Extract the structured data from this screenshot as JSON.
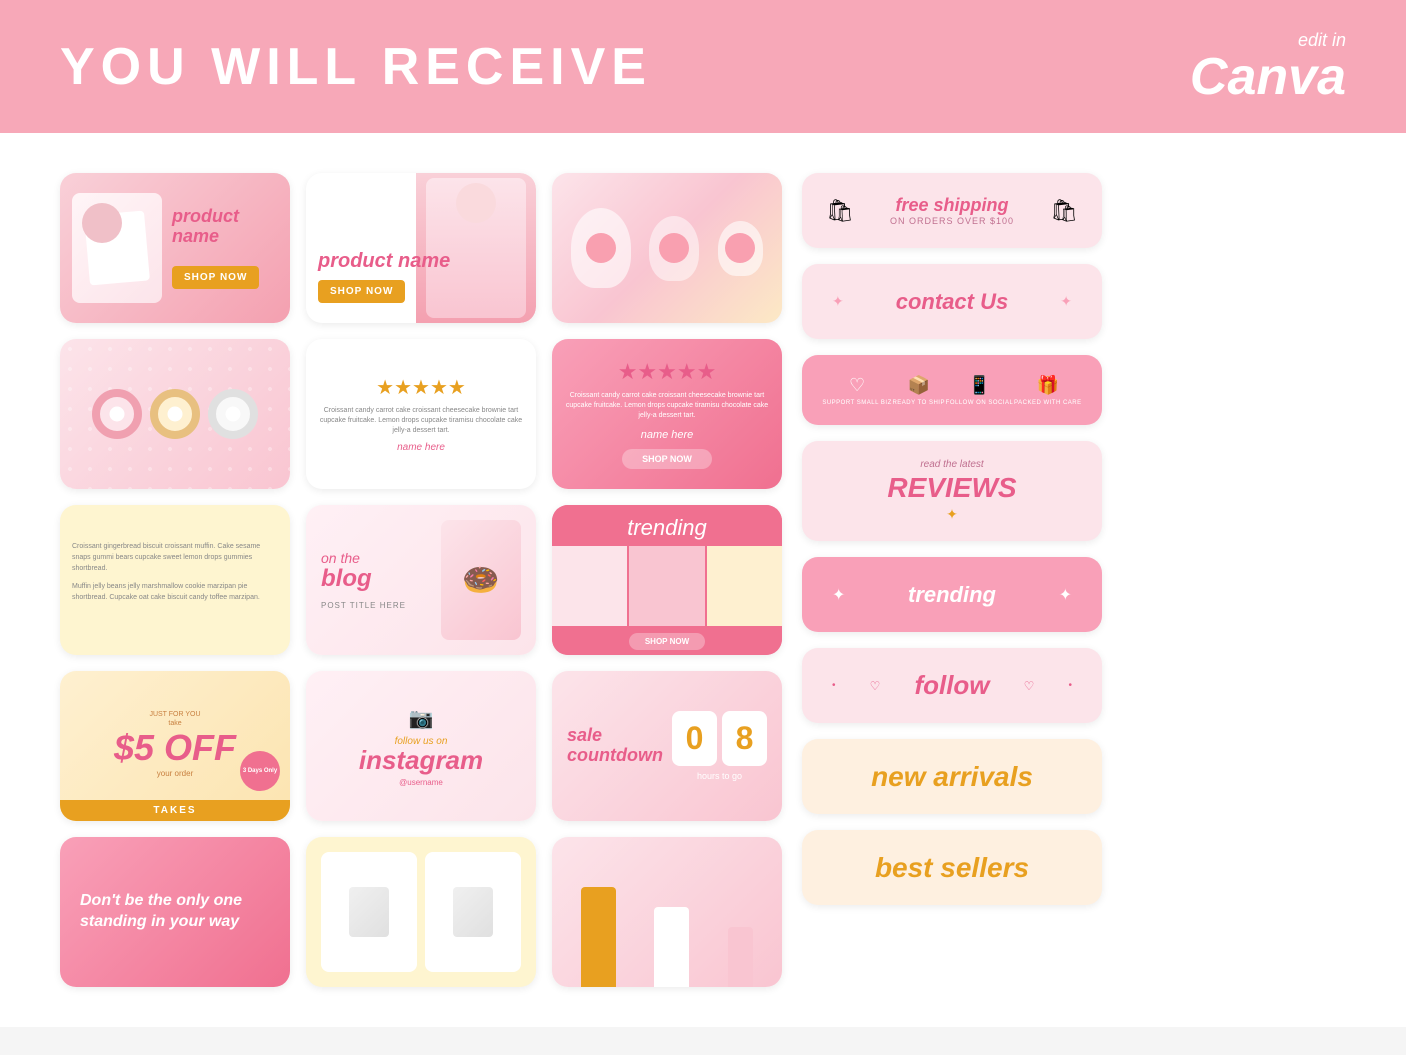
{
  "header": {
    "title": "YOU WILL RECEIVE",
    "canva_edit": "edit in",
    "canva_name": "Canva"
  },
  "cards": {
    "product1": {
      "name": "product name",
      "btn": "SHOP NOW"
    },
    "product2": {
      "name": "product name",
      "btn": "SHOP NOW"
    },
    "review1": {
      "stars": "★★★★★",
      "text": "Croissant candy carrot cake croissant cheesecake brownie tart cupcake fruitcake. Lemon drops cupcake tiramisu chocolate cake jelly-a dessert tart.",
      "name": "name here"
    },
    "review2": {
      "stars": "★★★★★",
      "text": "Croissant candy carrot cake croissant cheesecake brownie tart cupcake fruitcake. Lemon drops cupcake tiramisu chocolate cake jelly-a dessert tart.",
      "name": "name here",
      "btn": "SHOP NOW"
    },
    "blogText": {
      "para1": "Croissant gingerbread biscuit croissant muffin. Cake sesame snaps gummi bears cupcake sweet lemon drops gummies shortbread.",
      "para2": "Muffin jelly beans jelly marshmallow cookie marzipan pie shortbread. Cupcake oat cake biscuit candy toffee marzipan."
    },
    "blog": {
      "prefix": "on the",
      "title": "blog",
      "post": "POST TITLE HERE"
    },
    "trending": {
      "title": "trending",
      "btn": "SHOP NOW"
    },
    "discount": {
      "just": "JUST FOR YOU",
      "take": "take",
      "amount": "$5 OFF",
      "sub": "your order",
      "badge": "3 Days Only",
      "footer": "TAKES"
    },
    "instagram": {
      "follow_prefix": "follow us on",
      "platform": "instagram",
      "username": "@username"
    },
    "countdown": {
      "label": "sale countdown",
      "num1": "0",
      "num2": "8",
      "sub": "hours to go"
    },
    "motivational": {
      "text": "Don't be the only one standing in your way"
    },
    "candle": {
      "alt": "candle product"
    }
  },
  "sidebar": {
    "shipping": {
      "main": "free shipping",
      "sub": "ON ORDERS OVER $100",
      "icon_left": "🛍",
      "icon_right": "🛍"
    },
    "contact": {
      "label": "contact Us",
      "icon_left": "✦",
      "icon_right": "✦"
    },
    "icons": [
      {
        "icon": "♡",
        "label": "SUPPORT SMALL BIZ"
      },
      {
        "icon": "📦",
        "label": "READY TO SHIP"
      },
      {
        "icon": "📱",
        "label": "FOLLOW ON SOCIAL"
      },
      {
        "icon": "🎁",
        "label": "PACKED WITH CARE"
      }
    ],
    "reviews": {
      "sub": "read the latest",
      "main": "REVIEWS",
      "star": "✦"
    },
    "trending": {
      "label": "trending",
      "sparkle_left": "✦",
      "sparkle_right": "✦"
    },
    "follow": {
      "label": "follow",
      "dot_left": "•",
      "heart": "♡",
      "dot_right": "•"
    },
    "new_arrivals": {
      "label": "new arrivals"
    },
    "best_sellers": {
      "label": "best sellers"
    }
  }
}
